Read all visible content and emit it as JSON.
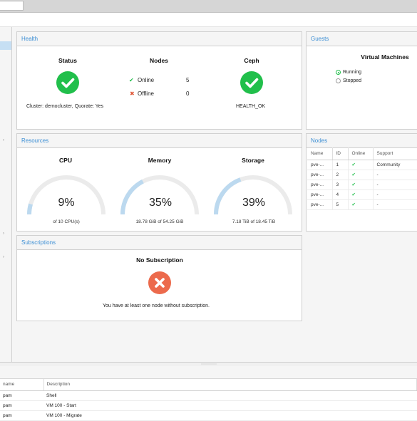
{
  "health": {
    "title": "Health",
    "status_label": "Status",
    "cluster_text": "Cluster: democluster, Quorate: Yes",
    "nodes_label": "Nodes",
    "online_label": "Online",
    "online_count": "5",
    "offline_label": "Offline",
    "offline_count": "0",
    "ceph_label": "Ceph",
    "ceph_status": "HEALTH_OK"
  },
  "guests": {
    "title": "Guests",
    "vm_header": "Virtual Machines",
    "running_label": "Running",
    "stopped_label": "Stopped"
  },
  "resources": {
    "title": "Resources",
    "cpu": {
      "label": "CPU",
      "percent": 9,
      "percent_text": "9%",
      "detail": "of 10 CPU(s)"
    },
    "memory": {
      "label": "Memory",
      "percent": 35,
      "percent_text": "35%",
      "detail": "18.78 GiB of 54.25 GiB"
    },
    "storage": {
      "label": "Storage",
      "percent": 39,
      "percent_text": "39%",
      "detail": "7.18 TiB of 18.45 TiB"
    }
  },
  "nodes_panel": {
    "title": "Nodes",
    "columns": [
      "Name",
      "ID",
      "Online",
      "Support"
    ],
    "rows": [
      {
        "name": "pve-...",
        "id": "1",
        "support": "Community"
      },
      {
        "name": "pve-...",
        "id": "2",
        "support": "-"
      },
      {
        "name": "pve-...",
        "id": "3",
        "support": "-"
      },
      {
        "name": "pve-...",
        "id": "4",
        "support": "-"
      },
      {
        "name": "pve-...",
        "id": "5",
        "support": "-"
      }
    ]
  },
  "subscriptions": {
    "title": "Subscriptions",
    "heading": "No Subscription",
    "message": "You have at least one node without subscription."
  },
  "log": {
    "columns": [
      "name",
      "Description"
    ],
    "rows": [
      {
        "user": "pam",
        "desc": "Shell"
      },
      {
        "user": "pam",
        "desc": "VM 100 - Start"
      },
      {
        "user": "pam",
        "desc": "VM 100 - Migrate"
      }
    ]
  },
  "colors": {
    "ok": "#21bf4b",
    "error": "#ec6a4c",
    "accent": "#3b8ed4",
    "gauge_track": "#ebebeb",
    "gauge_fill": "#bcd9ef"
  }
}
